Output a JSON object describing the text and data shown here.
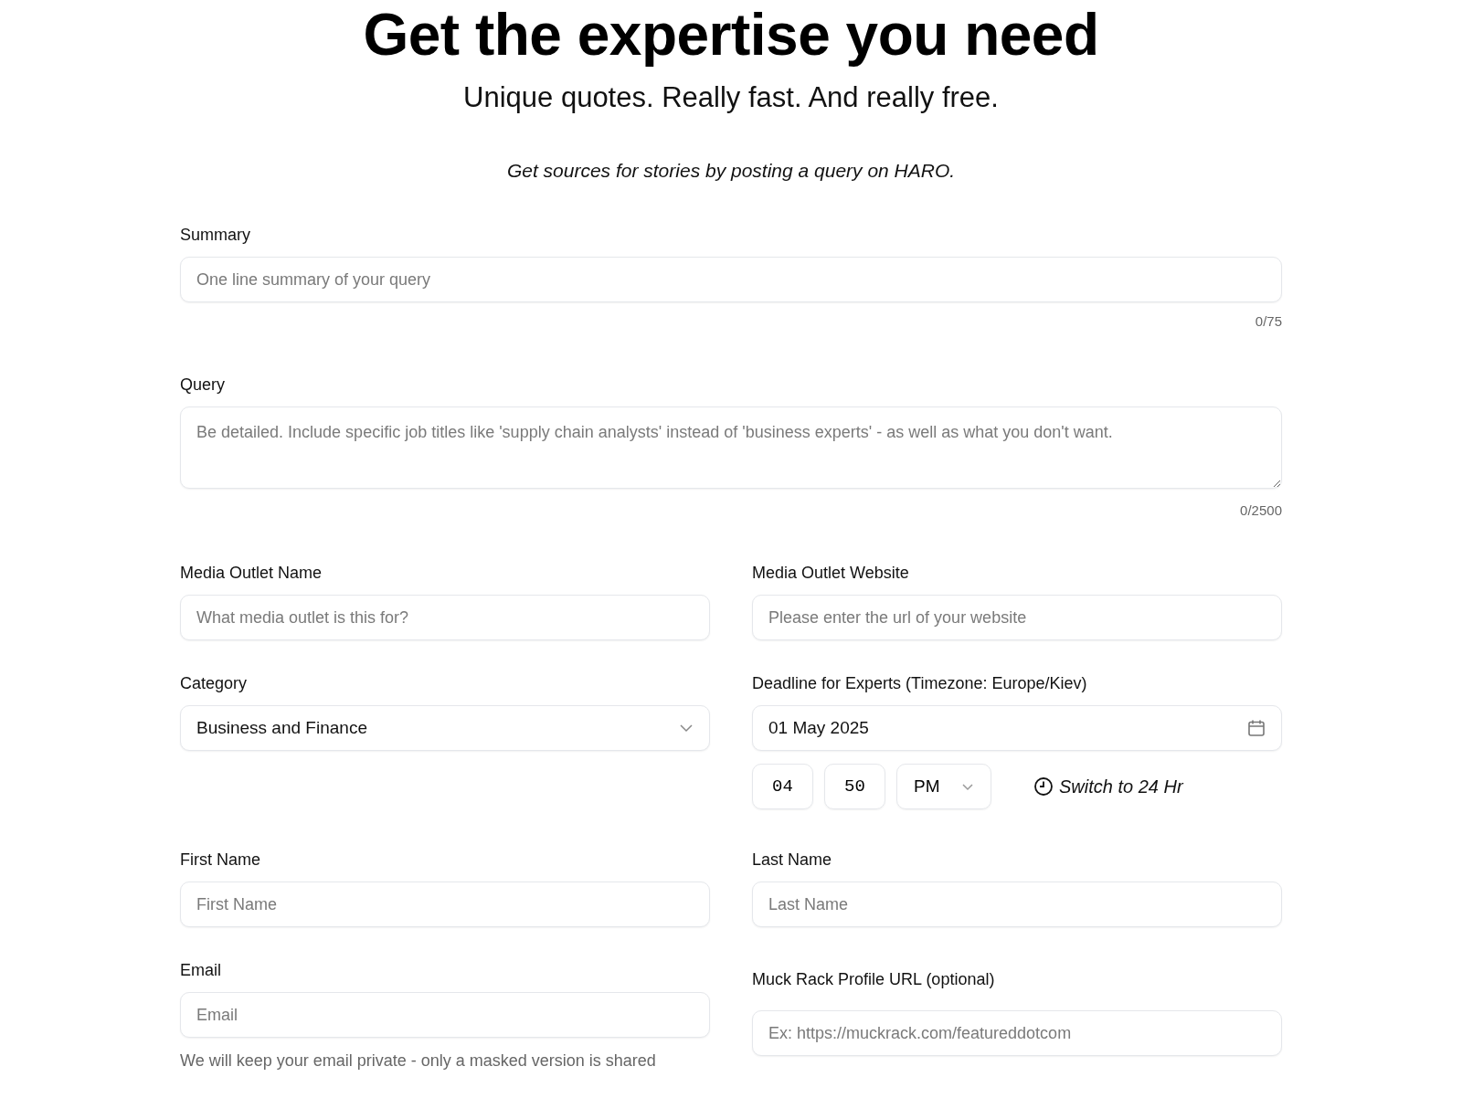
{
  "heading": "Get the expertise you need",
  "subheading": "Unique quotes. Really fast. And really free.",
  "intro": "Get sources for stories by posting a query on HARO.",
  "summary": {
    "label": "Summary",
    "placeholder": "One line summary of your query",
    "counter": "0/75"
  },
  "query": {
    "label": "Query",
    "placeholder": "Be detailed. Include specific job titles like 'supply chain analysts' instead of 'business experts' - as well as what you don't want.",
    "counter": "0/2500"
  },
  "media_outlet_name": {
    "label": "Media Outlet Name",
    "placeholder": "What media outlet is this for?"
  },
  "media_outlet_website": {
    "label": "Media Outlet Website",
    "placeholder": "Please enter the url of your website"
  },
  "category": {
    "label": "Category",
    "value": "Business and Finance"
  },
  "deadline": {
    "label": "Deadline for Experts (Timezone: Europe/Kiev)",
    "date": "01 May 2025",
    "hour": "04",
    "minute": "50",
    "period": "PM",
    "switch_label": "Switch to 24 Hr"
  },
  "first_name": {
    "label": "First Name",
    "placeholder": "First Name"
  },
  "last_name": {
    "label": "Last Name",
    "placeholder": "Last Name"
  },
  "email": {
    "label": "Email",
    "placeholder": "Email",
    "help": "We will keep your email private - only a masked version is shared"
  },
  "muck_rack": {
    "label": "Muck Rack Profile URL (optional)",
    "placeholder": "Ex: https://muckrack.com/featureddotcom"
  }
}
